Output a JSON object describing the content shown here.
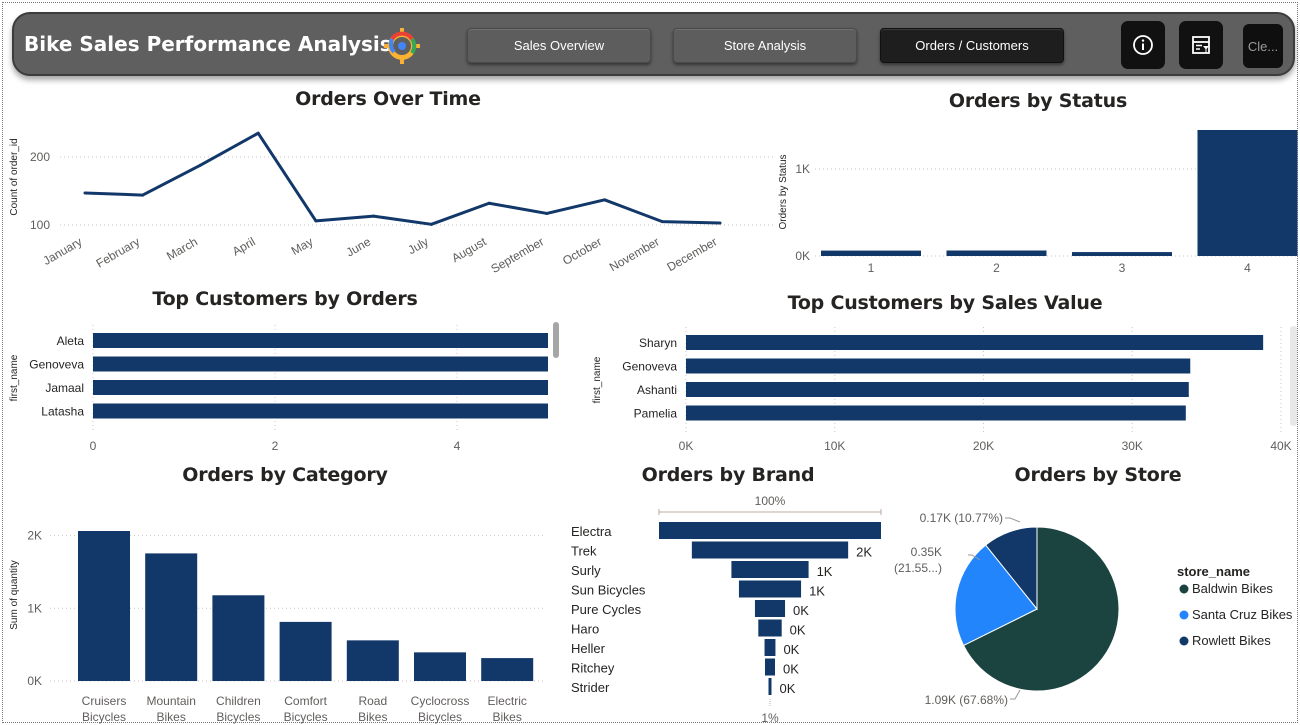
{
  "header": {
    "title": "Bike Sales Performance Analysis",
    "nav": [
      {
        "label": "Sales Overview",
        "active": false
      },
      {
        "label": "Store Analysis",
        "active": false
      },
      {
        "label": "Orders / Customers",
        "active": true
      }
    ],
    "info_icon": "info-icon",
    "filter_icon": "filter-panel-icon",
    "clear_label": "Cle..."
  },
  "colors": {
    "primary": "#12386a",
    "baldwin": "#1b4440",
    "santa_cruz": "#2285fb",
    "rowlett": "#12386a",
    "header_bg": "#5f5f5f"
  },
  "chart_data": [
    {
      "type": "line",
      "title": "Orders Over Time",
      "xlabel": "",
      "ylabel": "Count of order_id",
      "categories": [
        "January",
        "February",
        "March",
        "April",
        "May",
        "June",
        "July",
        "August",
        "September",
        "October",
        "November",
        "December"
      ],
      "values": [
        147,
        144,
        188,
        235,
        106,
        113,
        101,
        132,
        117,
        137,
        105,
        103
      ],
      "yticks": [
        "100",
        "200"
      ],
      "ylim": [
        90,
        240
      ],
      "grid": true
    },
    {
      "type": "bar",
      "title": "Orders by Status",
      "xlabel": "",
      "ylabel": "Orders by Status",
      "categories": [
        "1",
        "2",
        "3",
        "4"
      ],
      "values": [
        62,
        63,
        45,
        1445
      ],
      "yticks": [
        "0K",
        "1K"
      ],
      "ylim": [
        0,
        1445
      ],
      "grid": true
    },
    {
      "type": "bar",
      "orientation": "horizontal",
      "title": "Top Customers by Orders",
      "xlabel": "",
      "ylabel": "first_name",
      "categories": [
        "Aleta",
        "Genoveva",
        "Jamaal",
        "Latasha"
      ],
      "values": [
        5,
        5,
        5,
        5
      ],
      "xticks": [
        "0",
        "2",
        "4"
      ],
      "xlim": [
        0,
        5
      ],
      "grid": true
    },
    {
      "type": "bar",
      "orientation": "horizontal",
      "title": "Top Customers by Sales Value",
      "xlabel": "",
      "ylabel": "first_name",
      "categories": [
        "Sharyn",
        "Genoveva",
        "Ashanti",
        "Pamelia"
      ],
      "values": [
        38800,
        33900,
        33800,
        33600
      ],
      "xticks": [
        "0K",
        "10K",
        "20K",
        "30K",
        "40K"
      ],
      "xlim": [
        0,
        40000
      ],
      "grid": true
    },
    {
      "type": "bar",
      "title": "Orders by Category",
      "xlabel": "",
      "ylabel": "Sum of quantity",
      "categories": [
        "Cruisers Bicycles",
        "Mountain Bikes",
        "Children Bicycles",
        "Comfort Bicycles",
        "Road Bikes",
        "Cyclocross Bicycles",
        "Electric Bikes"
      ],
      "values": [
        2063,
        1755,
        1179,
        813,
        559,
        394,
        315
      ],
      "yticks": [
        "0K",
        "1K",
        "2K"
      ],
      "ylim": [
        0,
        2063
      ],
      "grid": true
    },
    {
      "type": "funnel",
      "title": "Orders by Brand",
      "categories": [
        "Electra",
        "Trek",
        "Surly",
        "Sun Bicycles",
        "Pure Cycles",
        "Haro",
        "Heller",
        "Ritchey",
        "Strider"
      ],
      "values": [
        2612,
        1839,
        908,
        731,
        354,
        275,
        128,
        118,
        27
      ],
      "value_labels": [
        "",
        "2K",
        "1K",
        "1K",
        "0K",
        "0K",
        "0K",
        "0K",
        "0K"
      ],
      "top_percent": "100%",
      "bottom_percent": "1%"
    },
    {
      "type": "pie",
      "title": "Orders by Store",
      "legend_title": "store_name",
      "legend_position": "right",
      "slices": [
        {
          "name": "Baldwin Bikes",
          "value": 1093,
          "label": "1.09K (67.68%)",
          "percent": 67.68
        },
        {
          "name": "Santa Cruz Bikes",
          "value": 348,
          "label_line1": "0.35K",
          "label_line2": "(21.55...)",
          "percent": 21.55
        },
        {
          "name": "Rowlett Bikes",
          "value": 174,
          "label": "0.17K (10.77%)",
          "percent": 10.77
        }
      ]
    }
  ]
}
